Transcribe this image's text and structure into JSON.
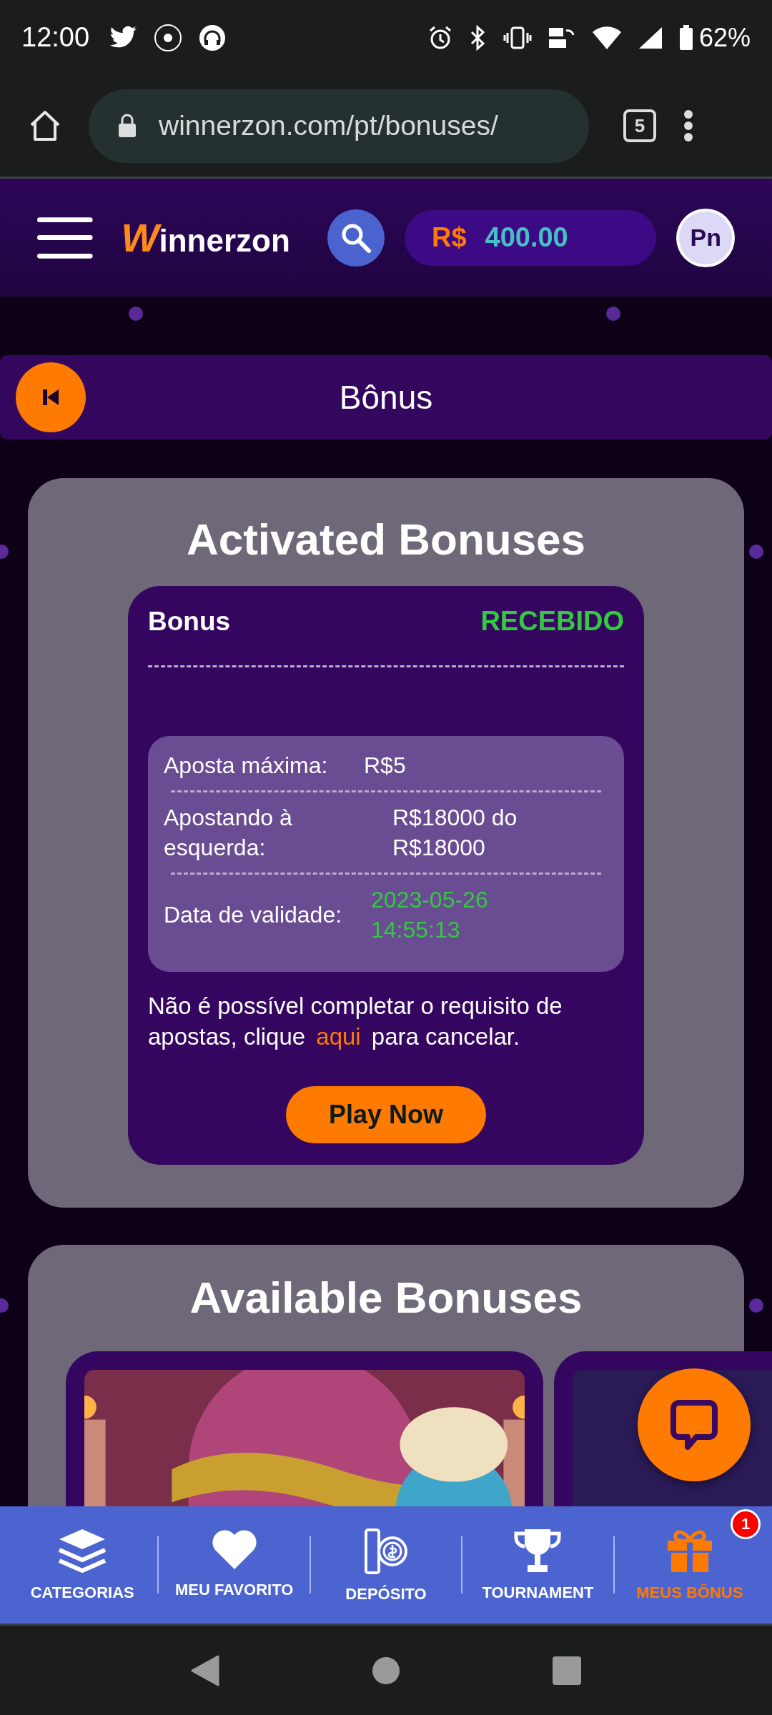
{
  "status_bar": {
    "time": "12:00",
    "battery": "62%"
  },
  "browser": {
    "url": "winnerzon.com/pt/bonuses/",
    "tab_count": "5"
  },
  "header": {
    "logo": "Winnerzon",
    "currency": "R$",
    "balance": "400.00",
    "avatar": "Pn"
  },
  "page_title": "Bônus",
  "activated": {
    "title": "Activated Bonuses",
    "bonus": {
      "name": "Bonus",
      "status": "RECEBIDO",
      "details": [
        {
          "kind": "plain",
          "label": "Aposta máxima:",
          "value": "R$5"
        },
        {
          "kind": "plain",
          "label": "Apostando à esquerda:",
          "value": "R$18000 do R$18000"
        },
        {
          "kind": "date",
          "label": "Data de validade:",
          "value": "2023-05-26 14:55:13"
        }
      ],
      "note": {
        "before": "Não é possível completar o requisito de apostas, clique",
        "link": "aqui",
        "after": "para cancelar."
      },
      "button": "Play Now"
    }
  },
  "available": {
    "title": "Available Bonuses"
  },
  "bottom_nav": [
    {
      "kind": "layers",
      "label": "CATEGORIAS",
      "selected": false
    },
    {
      "kind": "heart",
      "label": "MEU FAVORITO",
      "selected": false
    },
    {
      "kind": "coins",
      "label": "DEPÓSITO",
      "selected": false
    },
    {
      "kind": "trophy",
      "label": "TOURNAMENT",
      "selected": false
    },
    {
      "kind": "gift",
      "label": "MEUS BÔNUS",
      "selected": true,
      "badge": "1"
    }
  ]
}
